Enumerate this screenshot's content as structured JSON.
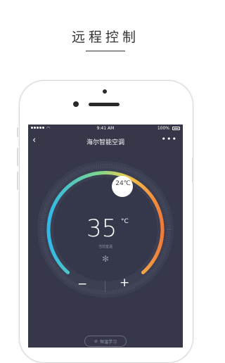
{
  "promo": {
    "title": "远程控制"
  },
  "status_bar": {
    "wifi_icon": "wifi-icon",
    "time": "9:41 AM",
    "battery": "100%"
  },
  "nav": {
    "back": "‹",
    "title": "海尔智能空调",
    "more": "•••"
  },
  "thermostat": {
    "current_temp": "35",
    "unit": "°C",
    "current_label": "当前室温",
    "target_label": "24℃",
    "target_temp": 24,
    "mode_icon": "snowflake-icon",
    "mode_glyph": "✻",
    "gradient": [
      "#2fb9e8",
      "#7fd88a",
      "#f2c94c",
      "#f07a3a"
    ]
  },
  "controls": {
    "minus": "−",
    "plus": "+"
  },
  "learn": {
    "label": "恒温学习"
  }
}
